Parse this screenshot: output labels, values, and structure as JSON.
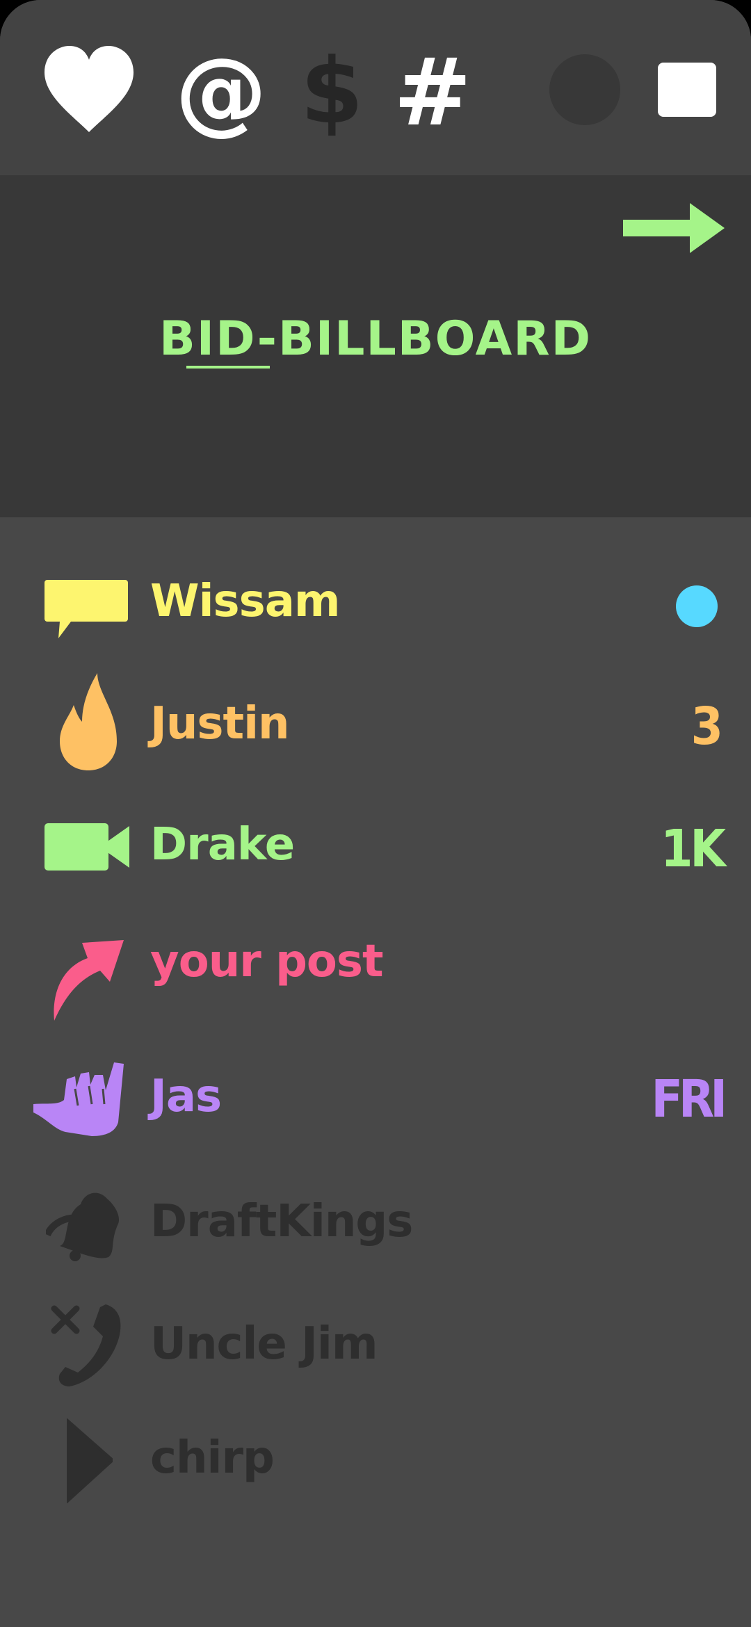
{
  "app": {
    "colors": {
      "background": "#484848",
      "top_bar": "#434343",
      "billboard": "#383838",
      "green": "#a5f489",
      "yellow": "#fdf56f",
      "orange": "#fec164",
      "pink": "#fa5d8b",
      "purple": "#b985f6",
      "blue_dot": "#57d9ff",
      "muted": "#2e2e2e"
    }
  },
  "top_bar": {
    "icons": [
      "heart-icon",
      "at-icon",
      "dollar-icon",
      "hash-icon",
      "status-circle-icon",
      "square-icon"
    ],
    "at_glyph": "@",
    "dollar_glyph": "$",
    "hash_glyph": "#"
  },
  "billboard": {
    "title": "BID-BILLBOARD",
    "arrow_icon": "arrow-right-icon"
  },
  "notifications": [
    {
      "icon": "chat-bubble-icon",
      "name": "Wissam",
      "meta": "",
      "badge": "unread-dot",
      "color": "#fdf56f"
    },
    {
      "icon": "flame-icon",
      "name": "Justin",
      "meta": "3",
      "color": "#fec164"
    },
    {
      "icon": "video-camera-icon",
      "name": "Drake",
      "meta": "1K",
      "color": "#a5f489"
    },
    {
      "icon": "share-arrow-icon",
      "name": "your post",
      "meta": "",
      "color": "#fa5d8b"
    },
    {
      "icon": "shaka-hand-icon",
      "name": "Jas",
      "meta": "FRI",
      "color": "#b985f6"
    },
    {
      "icon": "bell-icon",
      "name": "DraftKings",
      "meta": "",
      "color": "#2e2e2e"
    },
    {
      "icon": "missed-call-icon",
      "name": "Uncle Jim",
      "meta": "",
      "color": "#2e2e2e"
    },
    {
      "icon": "play-icon",
      "name": "chirp",
      "meta": "",
      "color": "#2e2e2e"
    }
  ]
}
